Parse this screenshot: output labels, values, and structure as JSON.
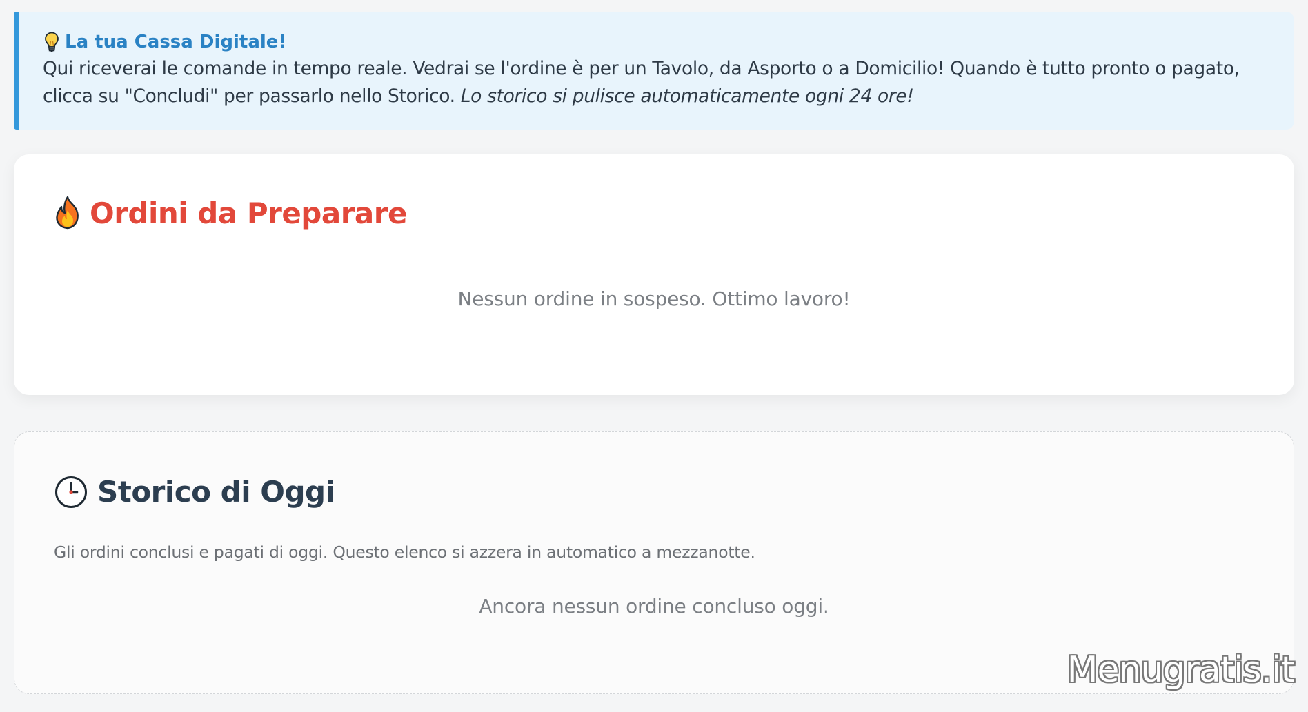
{
  "info_banner": {
    "icon": "lightbulb-icon",
    "title": "La tua Cassa Digitale!",
    "text": "Qui riceverai le comande in tempo reale. Vedrai se l'ordine è per un Tavolo, da Asporto o a Domicilio! Quando è tutto pronto o pagato, clicca su \"Concludi\" per passarlo nello Storico.",
    "text_italic": "Lo storico si pulisce automaticamente ogni 24 ore!"
  },
  "orders": {
    "icon": "fire-icon",
    "title": "Ordini da Preparare",
    "empty_message": "Nessun ordine in sospeso. Ottimo lavoro!"
  },
  "history": {
    "icon": "clock-icon",
    "title": "Storico di Oggi",
    "subtitle": "Gli ordini conclusi e pagati di oggi. Questo elenco si azzera in automatico a mezzanotte.",
    "empty_message": "Ancora nessun ordine concluso oggi."
  },
  "watermark": "Menugratis.it",
  "colors": {
    "banner_bg": "#e8f4fc",
    "banner_accent": "#3498db",
    "banner_title": "#2a82c4",
    "orders_title": "#e2483a",
    "history_title": "#2c3e50",
    "muted_text": "#7b7f84"
  }
}
